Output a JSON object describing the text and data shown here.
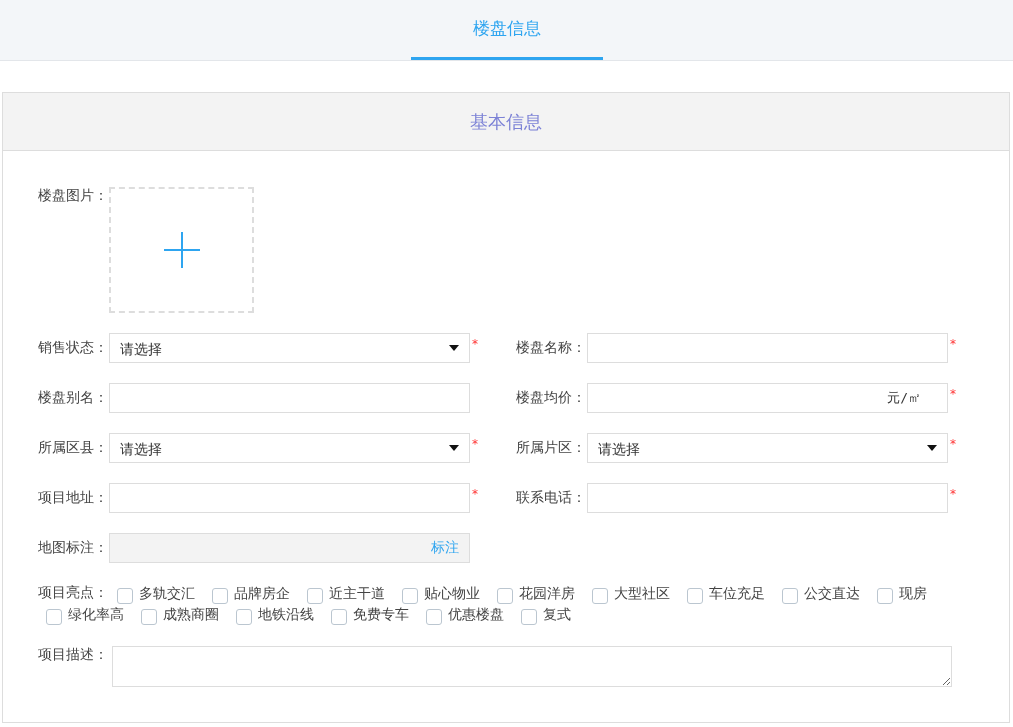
{
  "tabs": [
    {
      "label": "楼盘信息",
      "selected": true
    }
  ],
  "panel": {
    "title": "基本信息"
  },
  "image": {
    "label": "楼盘图片："
  },
  "fields": [
    {
      "label": "销售状态：",
      "kind": "select",
      "value": "请选择",
      "required_mark": "*"
    },
    {
      "label": "楼盘名称：",
      "kind": "text",
      "required_mark": "*"
    },
    {
      "label": "楼盘别名：",
      "kind": "text"
    },
    {
      "label": "楼盘均价：",
      "kind": "unit",
      "unit": "元/㎡",
      "required_mark": "*"
    },
    {
      "label": "所属区县：",
      "kind": "select",
      "value": "请选择",
      "required_mark": "*"
    },
    {
      "label": "所属片区：",
      "kind": "select",
      "value": "请选择",
      "required_mark": "*"
    },
    {
      "label": "项目地址：",
      "kind": "text",
      "required_mark": "*"
    },
    {
      "label": "联系电话：",
      "kind": "text",
      "required_mark": "*"
    },
    {
      "label": "地图标注：",
      "kind": "map",
      "action": "标注"
    }
  ],
  "highlights": {
    "label": "项目亮点：",
    "options": [
      {
        "label": "多轨交汇",
        "checked": false
      },
      {
        "label": "品牌房企",
        "checked": false
      },
      {
        "label": "近主干道",
        "checked": false
      },
      {
        "label": "贴心物业",
        "checked": false
      },
      {
        "label": "花园洋房",
        "checked": false
      },
      {
        "label": "大型社区",
        "checked": false
      },
      {
        "label": "车位充足",
        "checked": false
      },
      {
        "label": "公交直达",
        "checked": false
      },
      {
        "label": "现房",
        "checked": false
      },
      {
        "label": "绿化率高",
        "checked": false
      },
      {
        "label": "成熟商圈",
        "checked": false
      },
      {
        "label": "地铁沿线",
        "checked": false
      },
      {
        "label": "免费专车",
        "checked": false
      },
      {
        "label": "优惠楼盘",
        "checked": false
      },
      {
        "label": "复式",
        "checked": false
      }
    ]
  },
  "description": {
    "label": "项目描述："
  }
}
